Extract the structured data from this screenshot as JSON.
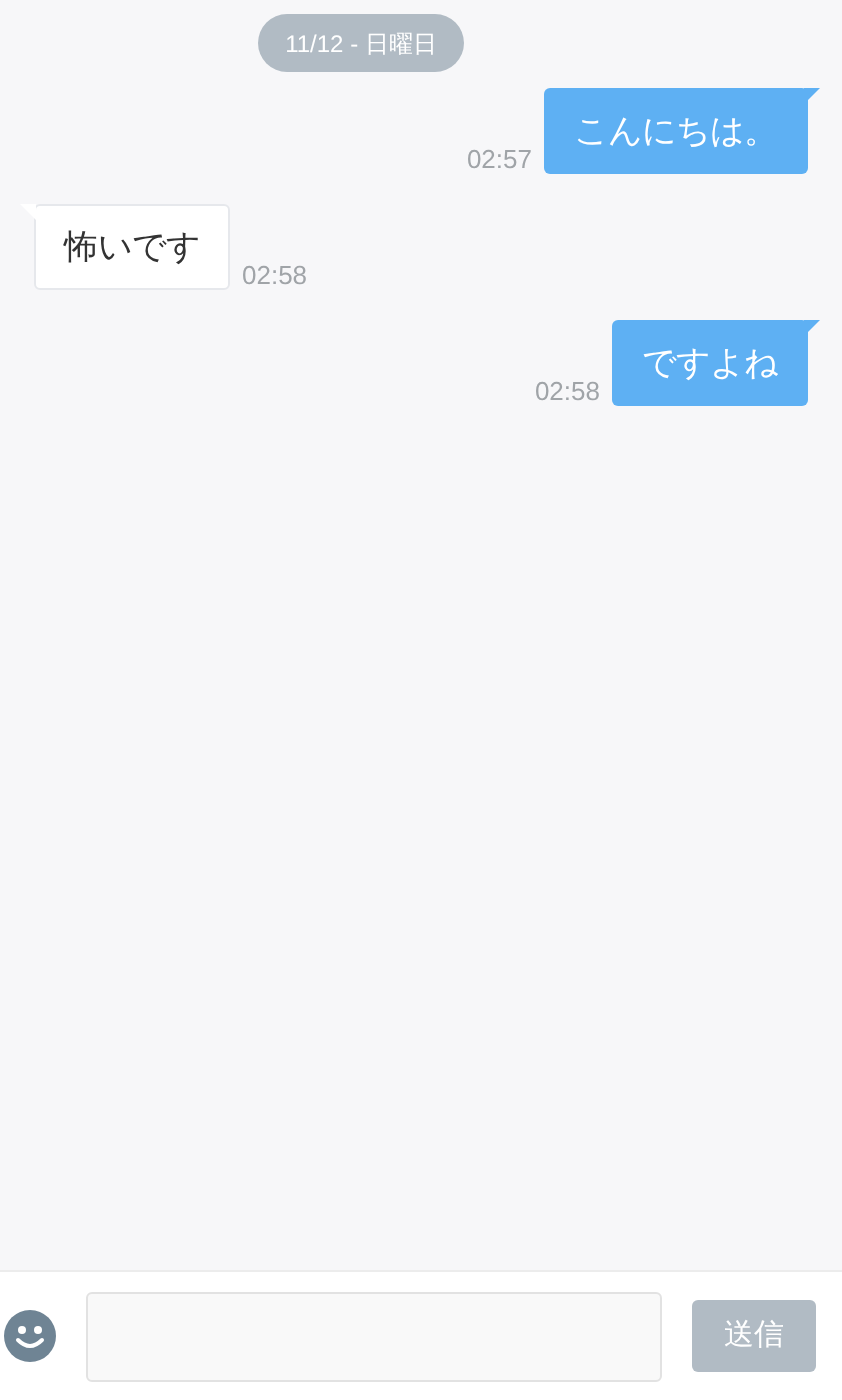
{
  "date_badge": "11/12 - 日曜日",
  "messages": [
    {
      "kind": "sent",
      "text": "こんにちは。",
      "time": "02:57"
    },
    {
      "kind": "received",
      "text": "怖いです",
      "time": "02:58"
    },
    {
      "kind": "sent",
      "text": "ですよね",
      "time": "02:58"
    }
  ],
  "composer": {
    "send_button": {
      "label": "送信",
      "disabled": true
    }
  }
}
